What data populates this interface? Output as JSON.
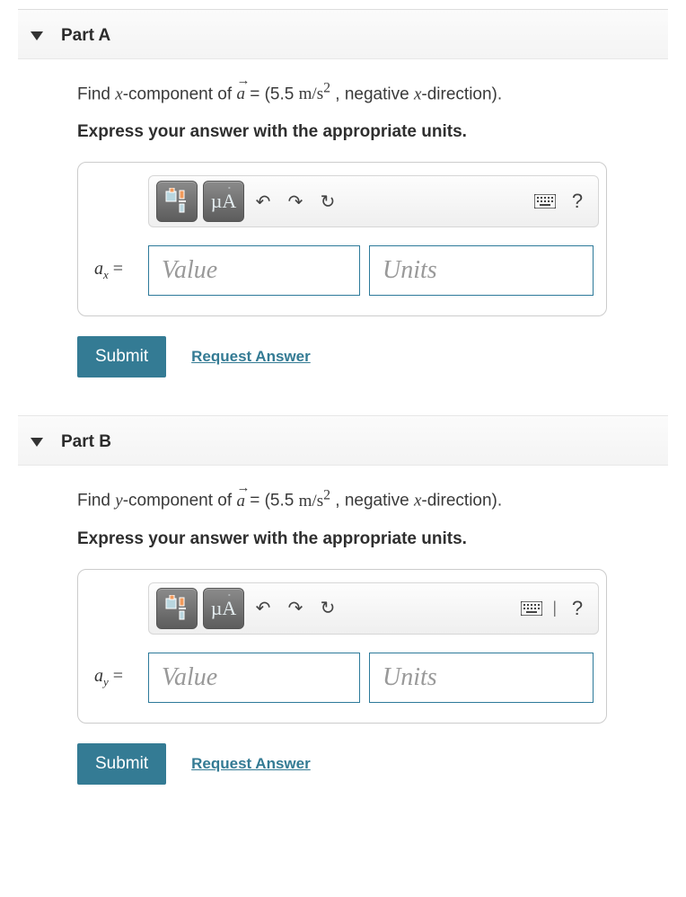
{
  "parts": [
    {
      "title": "Part A",
      "prompt_component_var": "x",
      "vector_symbol": "a",
      "vector_value": "5.5",
      "vector_units_num": "m",
      "vector_units_den": "s",
      "vector_units_exp": "2",
      "direction_text": ", negative ",
      "direction_var": "x",
      "direction_tail": "-direction).",
      "instruction": "Express your answer with the appropriate units.",
      "var_label_base": "a",
      "var_label_sub": "x",
      "equals": " =",
      "value_placeholder": "Value",
      "units_placeholder": "Units",
      "submit": "Submit",
      "request": "Request Answer",
      "toolbar": {
        "mu": "µ",
        "A": "A",
        "show_sep": false
      }
    },
    {
      "title": "Part B",
      "prompt_component_var": "y",
      "vector_symbol": "a",
      "vector_value": "5.5",
      "vector_units_num": "m",
      "vector_units_den": "s",
      "vector_units_exp": "2",
      "direction_text": ", negative ",
      "direction_var": "x",
      "direction_tail": "-direction).",
      "instruction": "Express your answer with the appropriate units.",
      "var_label_base": "a",
      "var_label_sub": "y",
      "equals": " =",
      "value_placeholder": "Value",
      "units_placeholder": "Units",
      "submit": "Submit",
      "request": "Request Answer",
      "toolbar": {
        "mu": "µ",
        "A": "A",
        "show_sep": true
      }
    }
  ],
  "common": {
    "find_prefix": "Find ",
    "component_word": "-component of ",
    "eq_open": " = (",
    "slash": "/"
  }
}
